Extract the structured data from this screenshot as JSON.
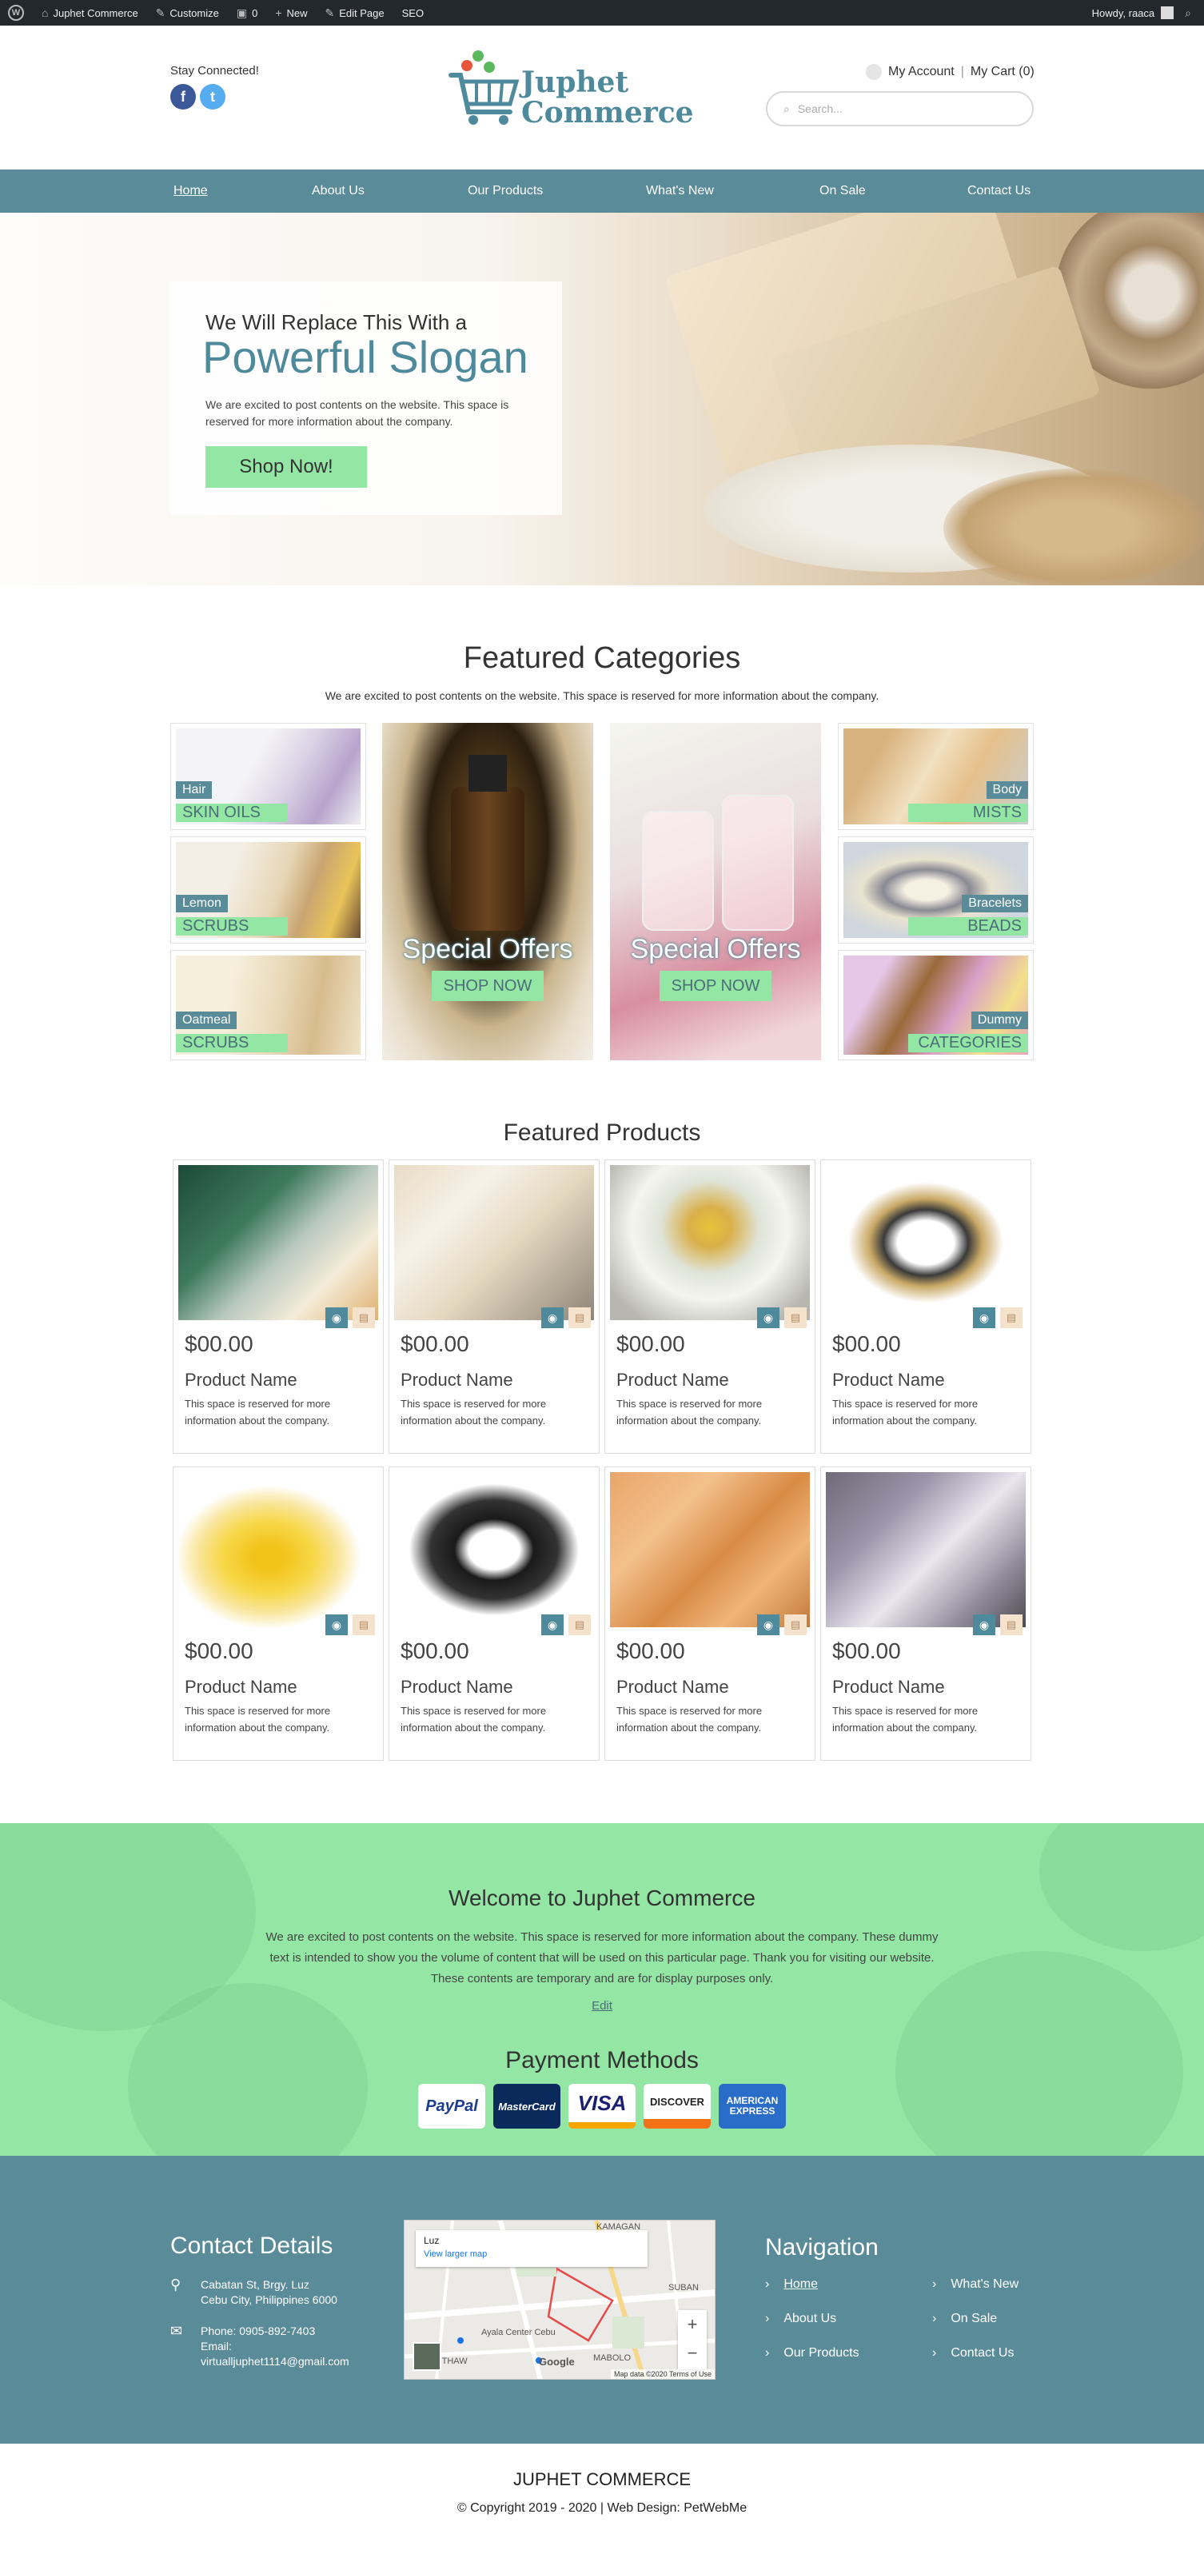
{
  "admin_bar": {
    "site_name": "Juphet Commerce",
    "customize": "Customize",
    "comments": "0",
    "new": "New",
    "edit_page": "Edit Page",
    "seo": "SEO",
    "howdy": "Howdy, raaca"
  },
  "header": {
    "stay_connected": "Stay Connected!",
    "logo_line1": "Juphet",
    "logo_line2": "Commerce",
    "my_account": "My Account",
    "my_cart": "My Cart (0)",
    "search_placeholder": "Search..."
  },
  "nav": [
    "Home",
    "About Us",
    "Our Products",
    "What's New",
    "On Sale",
    "Contact Us"
  ],
  "hero": {
    "small": "We Will Replace This With a",
    "big": "Powerful Slogan",
    "text": "We are excited to post contents on the website. This space is reserved for more information about the company.",
    "button": "Shop Now!"
  },
  "featured_categories": {
    "title": "Featured Categories",
    "subtitle": "We are excited to post contents on the website. This space is reserved for more information about the company.",
    "left": [
      {
        "l1": "Hair",
        "l2": "SKIN OILS"
      },
      {
        "l1": "Lemon",
        "l2": "SCRUBS"
      },
      {
        "l1": "Oatmeal",
        "l2": "SCRUBS"
      }
    ],
    "right": [
      {
        "l1": "Body",
        "l2": "MISTS"
      },
      {
        "l1": "Bracelets",
        "l2": "BEADS"
      },
      {
        "l1": "Dummy",
        "l2": "CATEGORIES"
      }
    ],
    "special": [
      {
        "title": "Special Offers",
        "button": "SHOP NOW"
      },
      {
        "title": "Special Offers",
        "button": "SHOP NOW"
      }
    ]
  },
  "featured_products": {
    "title": "Featured Products",
    "items": [
      {
        "price": "$00.00",
        "name": "Product Name",
        "desc": "This space is reserved for more information about the company."
      },
      {
        "price": "$00.00",
        "name": "Product Name",
        "desc": "This space is reserved for more information about the company."
      },
      {
        "price": "$00.00",
        "name": "Product Name",
        "desc": "This space is reserved for more information about the company."
      },
      {
        "price": "$00.00",
        "name": "Product Name",
        "desc": "This space is reserved for more information about the company."
      },
      {
        "price": "$00.00",
        "name": "Product Name",
        "desc": "This space is reserved for more information about the company."
      },
      {
        "price": "$00.00",
        "name": "Product Name",
        "desc": "This space is reserved for more information about the company."
      },
      {
        "price": "$00.00",
        "name": "Product Name",
        "desc": "This space is reserved for more information about the company."
      },
      {
        "price": "$00.00",
        "name": "Product Name",
        "desc": "This space is reserved for more information about the company."
      }
    ]
  },
  "welcome": {
    "title": "Welcome to Juphet Commerce",
    "text": "We are excited to post contents on the website. This space is reserved for more information about the company. These dummy text is intended to show you the volume of content that will be used on this particular page. Thank you for visiting our website. These contents are temporary and are for display purposes only.",
    "edit": "Edit",
    "payment_title": "Payment Methods",
    "cards": [
      "PayPal",
      "MasterCard",
      "VISA",
      "DISCOVER",
      "AMERICAN EXPRESS"
    ]
  },
  "footer": {
    "contact_title": "Contact Details",
    "address1": "Cabatan St, Brgy. Luz",
    "address2": "Cebu City, Philippines 6000",
    "phone": "Phone: 0905-892-7403",
    "email_label": "Email:",
    "email": "virtualljuphet1114@gmail.com",
    "map_place": "Luz",
    "map_link": "View larger map",
    "map_attr": "Map data ©2020  Terms of Use",
    "map_labels": [
      "KAMAGAN",
      "SUBAN",
      "Ayala Center Cebu",
      "KAUTHAW",
      "MABOLO"
    ],
    "nav_title": "Navigation",
    "nav_left": [
      "Home",
      "About Us",
      "Our Products"
    ],
    "nav_right": [
      "What's New",
      "On Sale",
      "Contact Us"
    ]
  },
  "bottom": {
    "title": "JUPHET COMMERCE",
    "copyright": "© Copyright 2019 - 2020  |  Web Design: PetWebMe"
  },
  "colors": {
    "teal": "#5a8b99",
    "mint": "#93e6a4",
    "brand": "#4e8a9c"
  }
}
